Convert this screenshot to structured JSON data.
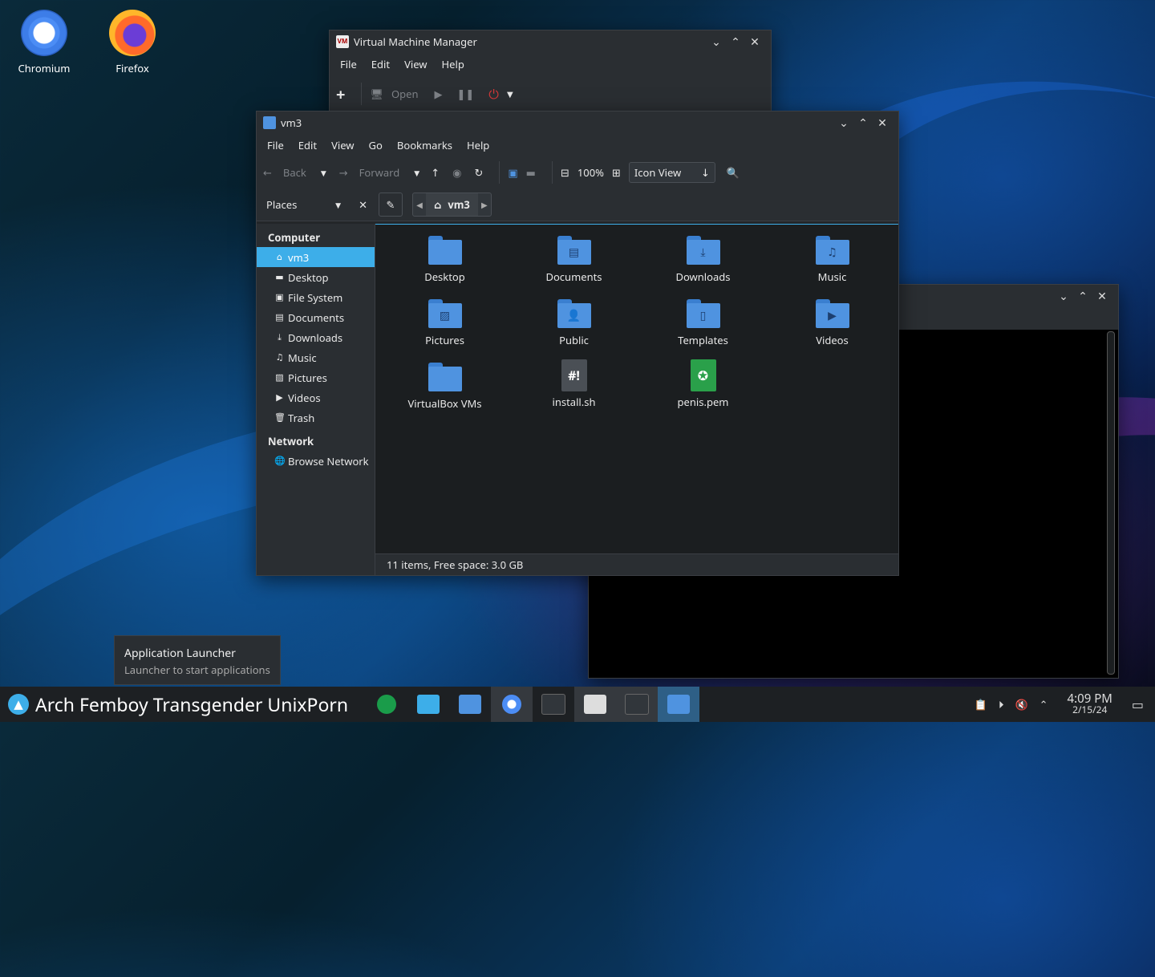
{
  "desktop": {
    "icons": [
      {
        "label": "Chromium"
      },
      {
        "label": "Firefox"
      }
    ]
  },
  "vmm": {
    "title": "Virtual Machine Manager",
    "menu": [
      "File",
      "Edit",
      "View",
      "Help"
    ],
    "toolbar": {
      "open_label": "Open"
    }
  },
  "fm": {
    "title": "vm3",
    "menu": [
      "File",
      "Edit",
      "View",
      "Go",
      "Bookmarks",
      "Help"
    ],
    "toolbar": {
      "back_label": "Back",
      "forward_label": "Forward",
      "zoom": "100%",
      "view_mode": "Icon View"
    },
    "places_label": "Places",
    "breadcrumb": "vm3",
    "sidebar": {
      "computer_header": "Computer",
      "computer_items": [
        {
          "label": "vm3",
          "icon": "home-icon"
        },
        {
          "label": "Desktop",
          "icon": "desktop-icon"
        },
        {
          "label": "File System",
          "icon": "drive-icon"
        },
        {
          "label": "Documents",
          "icon": "document-icon"
        },
        {
          "label": "Downloads",
          "icon": "download-icon"
        },
        {
          "label": "Music",
          "icon": "music-icon"
        },
        {
          "label": "Pictures",
          "icon": "picture-icon"
        },
        {
          "label": "Videos",
          "icon": "video-icon"
        },
        {
          "label": "Trash",
          "icon": "trash-icon"
        }
      ],
      "network_header": "Network",
      "network_items": [
        {
          "label": "Browse Network",
          "icon": "globe-icon"
        }
      ]
    },
    "items": [
      {
        "label": "Desktop",
        "kind": "folder"
      },
      {
        "label": "Documents",
        "kind": "folder"
      },
      {
        "label": "Downloads",
        "kind": "folder"
      },
      {
        "label": "Music",
        "kind": "folder"
      },
      {
        "label": "Pictures",
        "kind": "folder"
      },
      {
        "label": "Public",
        "kind": "folder"
      },
      {
        "label": "Templates",
        "kind": "folder"
      },
      {
        "label": "Videos",
        "kind": "folder"
      },
      {
        "label": "VirtualBox VMs",
        "kind": "folder"
      },
      {
        "label": "install.sh",
        "kind": "script"
      },
      {
        "label": "penis.pem",
        "kind": "certificate"
      }
    ],
    "status": "11 items, Free space: 3.0 GB"
  },
  "tooltip": {
    "title": "Application Launcher",
    "subtitle": "Launcher to start applications"
  },
  "taskbar": {
    "launcher_label": "Arch Femboy Transgender UnixPorn",
    "time": "4:09 PM",
    "date": "2/15/24"
  },
  "colors": {
    "accent": "#3daee9",
    "folder": "#4f93e0",
    "window_bg": "#232629"
  }
}
